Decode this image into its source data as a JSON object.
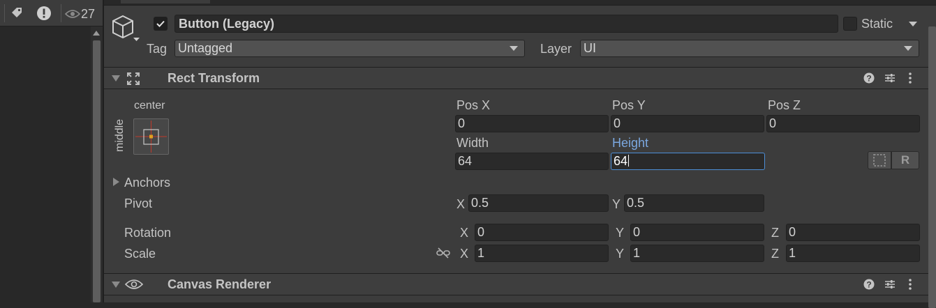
{
  "hierarchy_toolbar": {
    "visible_count": "27"
  },
  "gameobject": {
    "active_checked": true,
    "name": "Button (Legacy)",
    "static_label": "Static",
    "tag_label": "Tag",
    "tag_value": "Untagged",
    "layer_label": "Layer",
    "layer_value": "UI"
  },
  "rect_transform": {
    "title": "Rect Transform",
    "anchor_preset_h": "center",
    "anchor_preset_v": "middle",
    "pos_x_label": "Pos X",
    "pos_x": "0",
    "pos_y_label": "Pos Y",
    "pos_y": "0",
    "pos_z_label": "Pos Z",
    "pos_z": "0",
    "width_label": "Width",
    "width": "64",
    "height_label": "Height",
    "height": "64",
    "anchors_label": "Anchors",
    "pivot_label": "Pivot",
    "pivot_x_label": "X",
    "pivot_x": "0.5",
    "pivot_y_label": "Y",
    "pivot_y": "0.5",
    "rotation_label": "Rotation",
    "rot_x_label": "X",
    "rot_x": "0",
    "rot_y_label": "Y",
    "rot_y": "0",
    "rot_z_label": "Z",
    "rot_z": "0",
    "scale_label": "Scale",
    "scale_x_label": "X",
    "scale_x": "1",
    "scale_y_label": "Y",
    "scale_y": "1",
    "scale_z_label": "Z",
    "scale_z": "1",
    "raw_edit_button": "R"
  },
  "canvas_renderer": {
    "title": "Canvas Renderer"
  },
  "colors": {
    "focus": "#4d8fd8",
    "anchor_marker": "#e0a020",
    "anchor_lines": "#c0392b"
  },
  "icons": [
    "tag-icon",
    "warning-icon",
    "eye-icon",
    "gameobject-cube-icon",
    "checkmark-icon",
    "rect-transform-icon",
    "help-icon",
    "presets-icon",
    "more-icon",
    "unlink-scale-icon",
    "blueprint-mode-icon",
    "canvas-renderer-eye-icon"
  ]
}
